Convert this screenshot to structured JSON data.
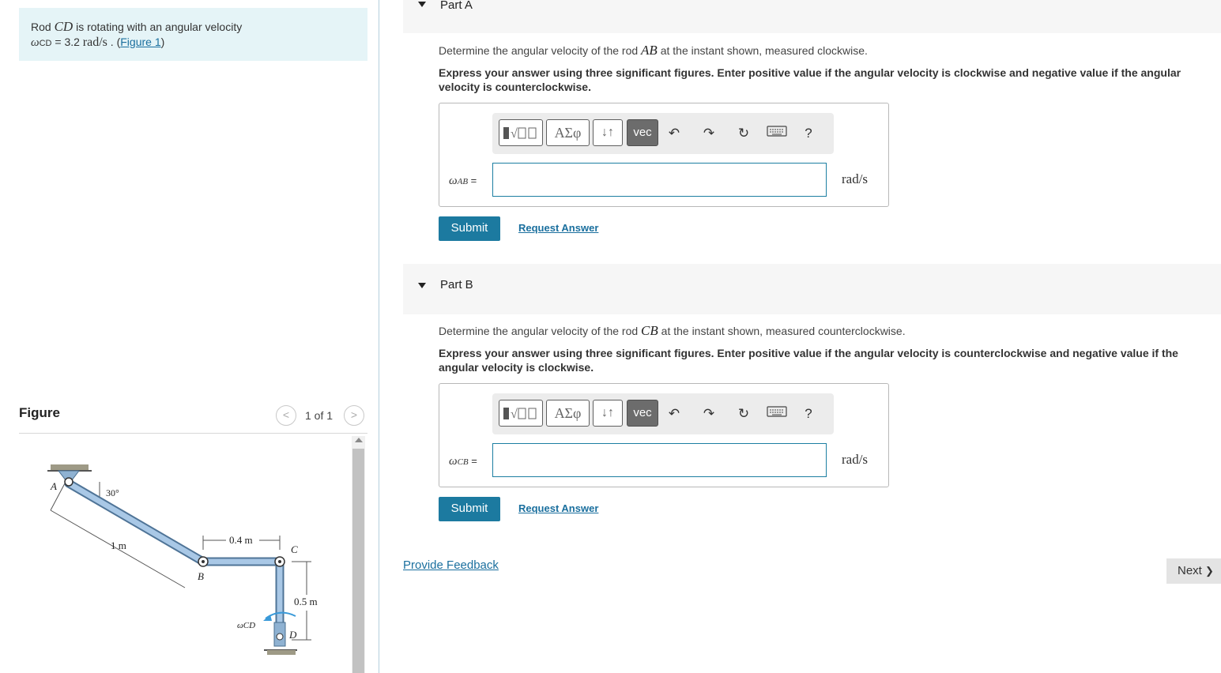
{
  "problem": {
    "text_prefix": "Rod ",
    "var": "CD",
    "text_suffix": " is rotating with an angular velocity",
    "omega_symbol": "ω",
    "omega_sub": "CD",
    "equals_value": " = 3.2 ",
    "unit": "rad/s",
    "period": " . (",
    "figure_link": "Figure 1",
    "close": ")"
  },
  "figure_panel": {
    "title": "Figure",
    "counter": "1 of 1",
    "prev": "<",
    "next": ">",
    "labels": {
      "A": "A",
      "B": "B",
      "C": "C",
      "D": "D",
      "angle": "30°",
      "len_ab": "1 m",
      "len_bc": "0.4 m",
      "len_cd": "0.5 m",
      "omega": "ωCD"
    }
  },
  "partA": {
    "label": "Part A",
    "question_prefix": "Determine the angular velocity of the rod ",
    "question_var": "AB",
    "question_suffix": " at the instant shown, measured clockwise.",
    "instructions": "Express your answer using three significant figures. Enter positive value if the angular velocity is clockwise and negative value if the angular velocity is counterclockwise.",
    "var_symbol": "ω",
    "var_sub": "AB",
    "var_eq": " =",
    "input_value": "",
    "unit": "rad/s",
    "submit": "Submit",
    "request": "Request Answer"
  },
  "partB": {
    "label": "Part B",
    "question_prefix": "Determine the angular velocity of the rod ",
    "question_var": "CB",
    "question_suffix": " at the instant shown, measured counterclockwise.",
    "instructions": "Express your answer using three significant figures. Enter positive value if the angular velocity is counterclockwise and negative value if the angular velocity is clockwise.",
    "var_symbol": "ω",
    "var_sub": "CB",
    "var_eq": " =",
    "input_value": "",
    "unit": "rad/s",
    "submit": "Submit",
    "request": "Request Answer"
  },
  "toolbar": {
    "greek": "ΑΣφ",
    "arrows": "↓↑",
    "vec": "vec",
    "undo": "↶",
    "redo": "↷",
    "reset": "↻",
    "help": "?"
  },
  "footer": {
    "feedback": "Provide Feedback",
    "next": "Next",
    "next_icon": "❯"
  },
  "colors": {
    "problem_bg": "#e5f4f7",
    "accent": "#1c7aa0",
    "link": "#1a6f9e",
    "part_header_bg": "#f6f6f6"
  }
}
